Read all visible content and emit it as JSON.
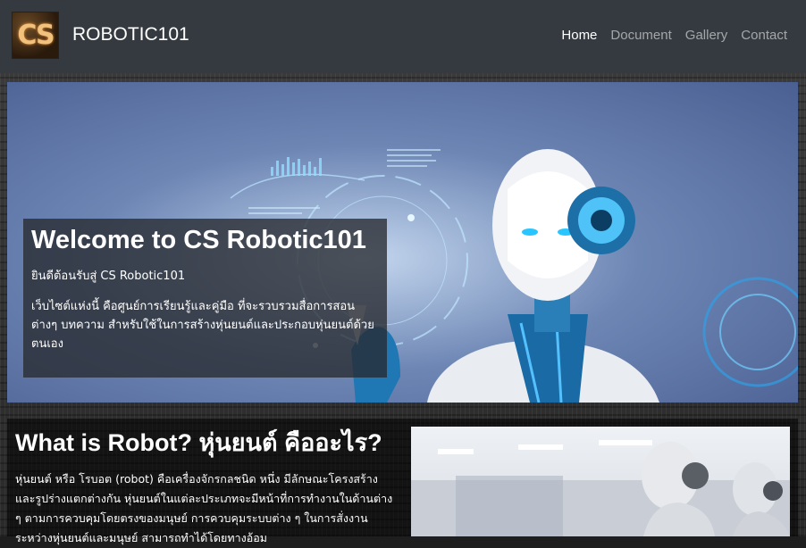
{
  "nav": {
    "brand": "ROBOTIC101",
    "logo_text": "CS",
    "links": [
      "Home",
      "Document",
      "Gallery",
      "Contact"
    ],
    "active": "Home"
  },
  "hero": {
    "title": "Welcome to CS Robotic101",
    "subtitle": "ยินดีต้อนรับสู่ CS Robotic101",
    "description": "เว็บไซต์แห่งนี้ คือศูนย์การเรียนรู้และคู่มือ ที่จะรวบรวมสื่อการสอนต่างๆ บทความ สำหรับใช้ในการสร้างหุ่นยนต์และประกอบหุ่นยนต์ด้วยตนเอง"
  },
  "section": {
    "title": "What is Robot? หุ่นยนต์ คืออะไร?",
    "body": "หุ่นยนต์ หรือ โรบอต (robot) คือเครื่องจักรกลชนิด หนึ่ง มีลักษณะโครงสร้างและรูปร่างแตกต่างกัน หุ่นยนต์ในแต่ละประเภทจะมีหน้าที่การทำงานในด้านต่าง ๆ ตามการควบคุมโดยตรงของมนุษย์ การควบคุมระบบต่าง ๆ ในการสั่งงานระหว่างหุ่นยนต์และมนุษย์ สามารถทำได้โดยทางอ้อม"
  },
  "colors": {
    "navbar": "#343a40",
    "nav_active": "#ffffff",
    "nav_inactive": "rgba(255,255,255,0.55)",
    "overlay": "rgba(40,42,48,0.78)"
  },
  "icons": [
    "cs-logo-icon"
  ]
}
